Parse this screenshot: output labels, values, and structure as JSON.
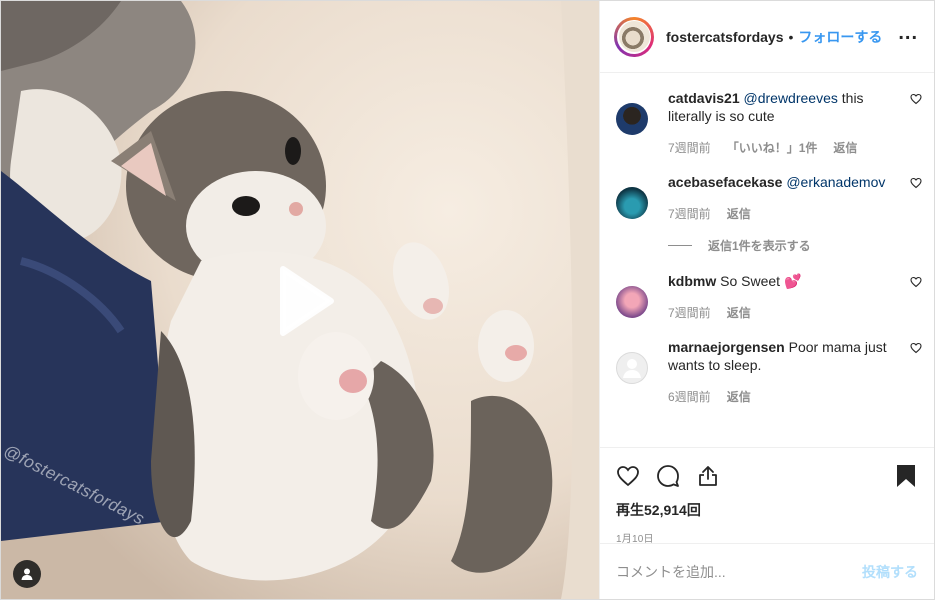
{
  "media": {
    "watermark": "@fostercatsfordays",
    "play_icon": "play-icon",
    "tag_icon": "user-tag-icon"
  },
  "header": {
    "username": "fostercatsfordays",
    "separator": "•",
    "follow_label": "フォローする",
    "more_label": "..."
  },
  "comments": [
    {
      "username": "catdavis21",
      "mention": "@drewdreeves",
      "text": " this literally is so cute",
      "time": "7週間前",
      "likes": "「いいね！」1件",
      "reply": "返信"
    },
    {
      "username": "acebasefacekase",
      "mention": "@erkanademov",
      "text": "",
      "time": "7週間前",
      "likes": "",
      "reply": "返信"
    },
    {
      "username": "kdbmw",
      "mention": "",
      "text": " So Sweet 💕",
      "time": "7週間前",
      "likes": "",
      "reply": "返信"
    },
    {
      "username": "marnaejorgensen",
      "mention": "",
      "text": " Poor mama just wants to sleep.",
      "time": "6週間前",
      "likes": "",
      "reply": "返信"
    }
  ],
  "view_replies_label": "返信1件を表示する",
  "actions": {
    "views": "再生52,914回",
    "date": "1月10日"
  },
  "add_comment": {
    "placeholder": "コメントを追加...",
    "post_label": "投稿する"
  },
  "colors": {
    "accent": "#3897f0",
    "post_disabled": "#b2dffc",
    "muted": "#8e8e8e"
  }
}
